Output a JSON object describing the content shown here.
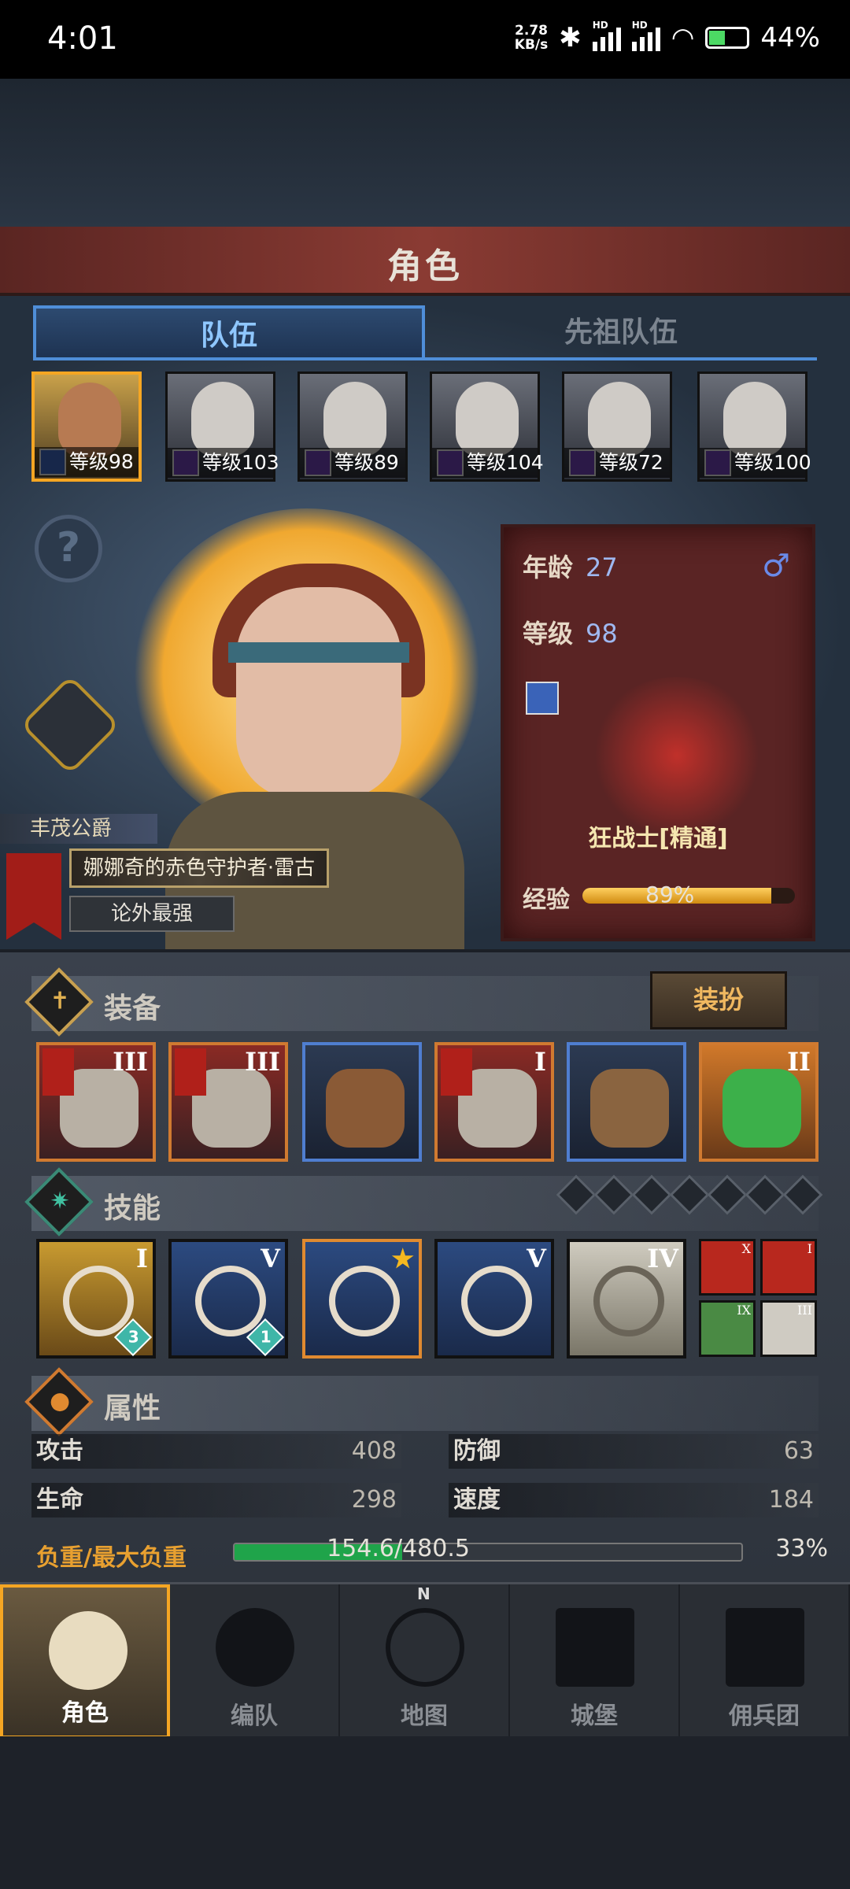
{
  "status": {
    "time": "4:01",
    "speed": "2.78",
    "speed_unit": "KB/s",
    "hd1": "HD",
    "hd2": "HD",
    "battery": "44%"
  },
  "header": {
    "title": "角色"
  },
  "tabs": [
    {
      "label": "队伍",
      "active": true
    },
    {
      "label": "先祖队伍",
      "active": false
    }
  ],
  "heroes": [
    {
      "level": "等级98",
      "selected": true
    },
    {
      "level": "等级103"
    },
    {
      "level": "等级89"
    },
    {
      "level": "等级104"
    },
    {
      "level": "等级72"
    },
    {
      "level": "等级100"
    }
  ],
  "help_icon": "question-icon",
  "character": {
    "rank": "丰茂公爵",
    "title": "娜娜奇的赤色守护者·雷古",
    "motto": "论外最强"
  },
  "stats": {
    "age_label": "年龄",
    "age": "27",
    "level_label": "等级",
    "level": "98",
    "gender_icon": "♂",
    "class_name": "狂战士[精通]",
    "exp_label": "经验",
    "exp_pct": "89%",
    "exp_fraction": 0.89
  },
  "equipment": {
    "title": "装备",
    "dress_button": "装扮",
    "slots": [
      {
        "roman": "III",
        "rarity": "orange"
      },
      {
        "roman": "III",
        "rarity": "orange"
      },
      {
        "roman": "",
        "rarity": "blue"
      },
      {
        "roman": "I",
        "rarity": "orange"
      },
      {
        "roman": "",
        "rarity": "blue"
      },
      {
        "roman": "II",
        "rarity": "orange"
      }
    ]
  },
  "skills": {
    "title": "技能",
    "items": [
      {
        "roman": "I",
        "gem": "3"
      },
      {
        "roman": "V",
        "gem": "1"
      },
      {
        "roman": "",
        "star": "★"
      },
      {
        "roman": "V"
      },
      {
        "roman": "IV"
      }
    ],
    "mini": [
      {
        "roman": "X"
      },
      {
        "roman": "I"
      },
      {
        "roman": "IX"
      },
      {
        "roman": "III"
      }
    ],
    "empty_slots": 7
  },
  "attributes": {
    "title": "属性",
    "attack_label": "攻击",
    "attack": "408",
    "defense_label": "防御",
    "defense": "63",
    "hp_label": "生命",
    "hp": "298",
    "speed_label": "速度",
    "speed": "184",
    "load_label": "负重/最大负重",
    "load": "154.6/480.5",
    "load_pct": "33%",
    "load_fraction": 0.33
  },
  "nav": [
    {
      "label": "角色",
      "icon": "knight-icon",
      "selected": true
    },
    {
      "label": "编队",
      "icon": "helmet-icon"
    },
    {
      "label": "地图",
      "icon": "compass-map-icon",
      "compass": "N"
    },
    {
      "label": "城堡",
      "icon": "castle-icon"
    },
    {
      "label": "佣兵团",
      "icon": "banner-icon"
    }
  ]
}
